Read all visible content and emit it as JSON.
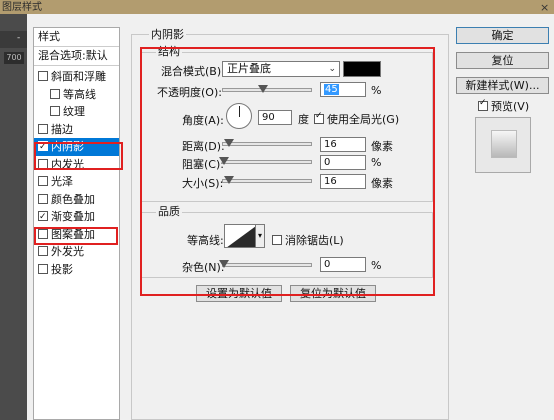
{
  "window": {
    "title": "图层样式",
    "close": "×"
  },
  "host": {
    "tick": "-",
    "number": "700"
  },
  "styles_list": {
    "header_styles": "样式",
    "header_blend": "混合选项:默认",
    "items": [
      {
        "label": "斜面和浮雕",
        "checked": false,
        "indent": false
      },
      {
        "label": "等高线",
        "checked": false,
        "indent": true
      },
      {
        "label": "纹理",
        "checked": false,
        "indent": true
      },
      {
        "label": "描边",
        "checked": false,
        "indent": false
      },
      {
        "label": "内阴影",
        "checked": true,
        "indent": false,
        "selected": true
      },
      {
        "label": "内发光",
        "checked": false,
        "indent": false
      },
      {
        "label": "光泽",
        "checked": false,
        "indent": false
      },
      {
        "label": "颜色叠加",
        "checked": false,
        "indent": false
      },
      {
        "label": "渐变叠加",
        "checked": true,
        "indent": false
      },
      {
        "label": "图案叠加",
        "checked": false,
        "indent": false
      },
      {
        "label": "外发光",
        "checked": false,
        "indent": false
      },
      {
        "label": "投影",
        "checked": false,
        "indent": false
      }
    ]
  },
  "panel": {
    "title": "内阴影",
    "structure": {
      "legend": "结构",
      "blend_mode_label": "混合模式(B):",
      "blend_mode_value": "正片叠底",
      "shadow_color": "#000000",
      "opacity_label": "不透明度(O):",
      "opacity_value": "45",
      "opacity_fraction": 0.45,
      "percent": "%",
      "angle_label": "角度(A):",
      "angle_value": "90",
      "degree": "度",
      "global_light_label": "使用全局光(G)",
      "global_light_checked": true,
      "distance_label": "距离(D):",
      "distance_value": "16",
      "distance_fraction": 0.064,
      "pixels": "像素",
      "choke_label": "阻塞(C):",
      "choke_value": "0",
      "size_label": "大小(S):",
      "size_value": "16",
      "size_fraction": 0.064
    },
    "quality": {
      "legend": "品质",
      "contour_label": "等高线:",
      "antialias_label": "消除锯齿(L)",
      "antialias_checked": false,
      "noise_label": "杂色(N):",
      "noise_value": "0",
      "percent": "%"
    },
    "buttons": {
      "set_default": "设置为默认值",
      "reset_default": "复位为默认值"
    }
  },
  "right": {
    "ok": "确定",
    "reset": "复位",
    "new_style": "新建样式(W)...",
    "preview_label": "预览(V)",
    "preview_checked": true
  },
  "colors": {
    "accent": "#0078d7",
    "annotation": "#e02020",
    "titlebar": "#b29c6f"
  }
}
